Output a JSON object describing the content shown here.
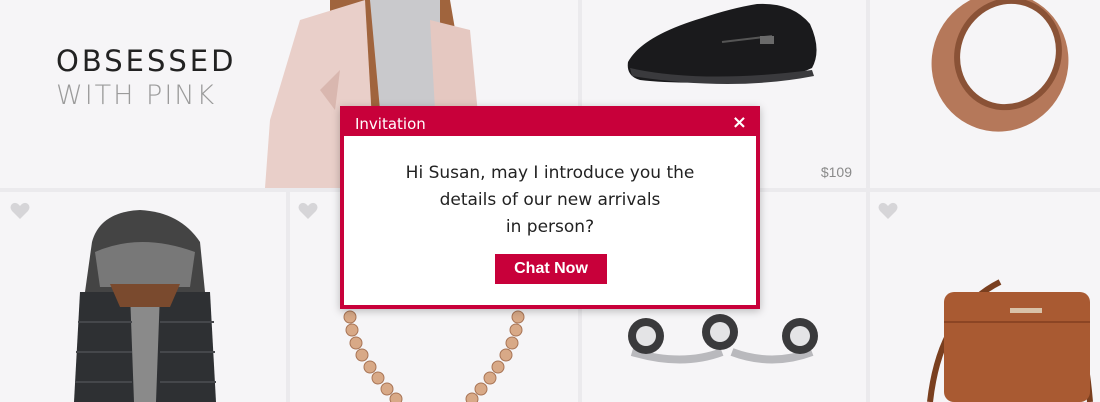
{
  "hero": {
    "line1": "OBSESSED",
    "line2": "WITH PINK"
  },
  "products": {
    "shoe": {
      "price": "$109"
    }
  },
  "modal": {
    "title": "Invitation",
    "close_label": "×",
    "message_lines": [
      "Hi Susan, may I introduce you the",
      "details of our new arrivals",
      "in person?"
    ],
    "button_label": "Chat Now"
  },
  "colors": {
    "accent": "#c8003a",
    "tile_bg": "#f6f5f7"
  },
  "icons": [
    "heart-icon",
    "close-icon"
  ]
}
